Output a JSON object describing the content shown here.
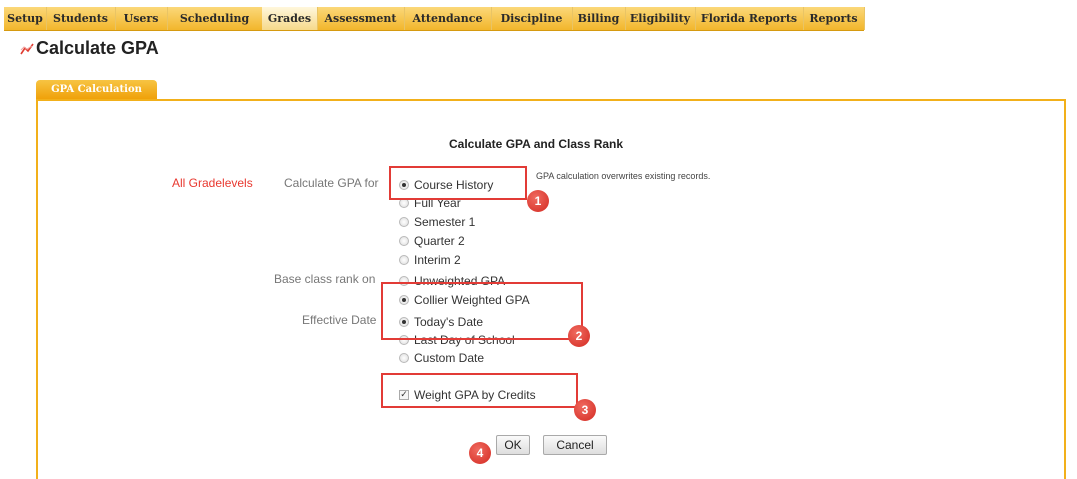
{
  "nav": {
    "items": [
      "Setup",
      "Students",
      "Users",
      "Scheduling",
      "Grades",
      "Assessment",
      "Attendance",
      "Discipline",
      "Billing",
      "Eligibility",
      "Florida Reports",
      "Reports"
    ],
    "active": "Grades"
  },
  "page": {
    "title": "Calculate GPA"
  },
  "tab": {
    "label": "GPA Calculation"
  },
  "form": {
    "heading": "Calculate GPA and Class Rank",
    "gradelevels_label": "All Gradelevels",
    "calculate_for_label": "Calculate GPA for",
    "note": "GPA calculation overwrites existing records.",
    "calculate_for_options": [
      "Course History",
      "Full Year",
      "Semester 1",
      "Quarter 2",
      "Interim 2"
    ],
    "calculate_for_selected": "Course History",
    "rank_label": "Base class rank on",
    "rank_options": [
      "Unweighted GPA",
      "Collier Weighted GPA"
    ],
    "rank_selected": "Collier Weighted GPA",
    "date_label": "Effective Date",
    "date_options": [
      "Today's Date",
      "Last Day of School",
      "Custom Date"
    ],
    "date_selected": "Today's Date",
    "weight_checkbox_label": "Weight GPA by Credits",
    "weight_checked": true,
    "ok_label": "OK",
    "cancel_label": "Cancel"
  },
  "annotations": [
    "1",
    "2",
    "3",
    "4"
  ],
  "colors": {
    "nav": "#f2b62c",
    "accent": "#ef9f06",
    "highlight": "#e23b36"
  }
}
